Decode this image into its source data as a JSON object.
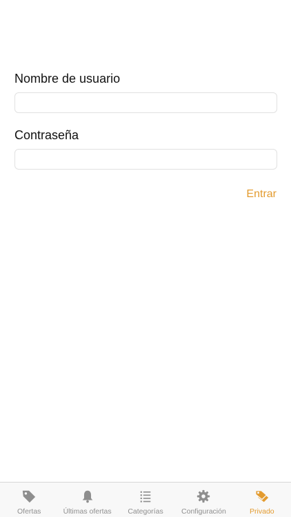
{
  "login": {
    "username_label": "Nombre de usuario",
    "username_value": "",
    "password_label": "Contraseña",
    "password_value": "",
    "submit_label": "Entrar"
  },
  "tabs": [
    {
      "label": "Ofertas",
      "icon": "tag-icon",
      "active": false
    },
    {
      "label": "Últimas ofertas",
      "icon": "bell-icon",
      "active": false
    },
    {
      "label": "Categorías",
      "icon": "list-icon",
      "active": false
    },
    {
      "label": "Configuración",
      "icon": "gear-icon",
      "active": false
    },
    {
      "label": "Privado",
      "icon": "tags-icon",
      "active": true
    }
  ],
  "colors": {
    "accent": "#e39b2f",
    "tab_inactive": "#8e8e8e",
    "text": "#111111"
  }
}
